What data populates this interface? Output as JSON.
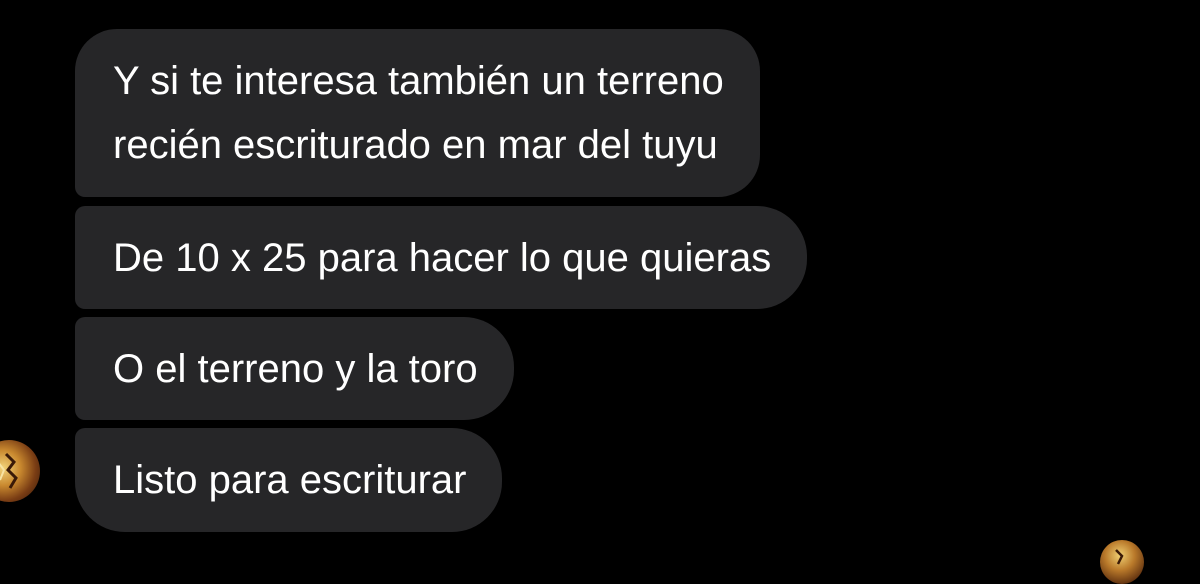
{
  "messages": [
    {
      "lines": [
        "Y si te interesa también un terreno",
        "recién escriturado en mar del tuyu"
      ]
    },
    {
      "lines": [
        "De 10 x 25 para hacer lo que quieras"
      ]
    },
    {
      "lines": [
        "O el terreno y la toro"
      ]
    },
    {
      "lines": [
        "Listo para escriturar"
      ]
    }
  ],
  "colors": {
    "background": "#000000",
    "bubble": "#262628",
    "text": "#ffffff"
  },
  "icons": {
    "sender_avatar": "avatar-image-icon",
    "read_receipt_avatar": "avatar-image-icon"
  }
}
